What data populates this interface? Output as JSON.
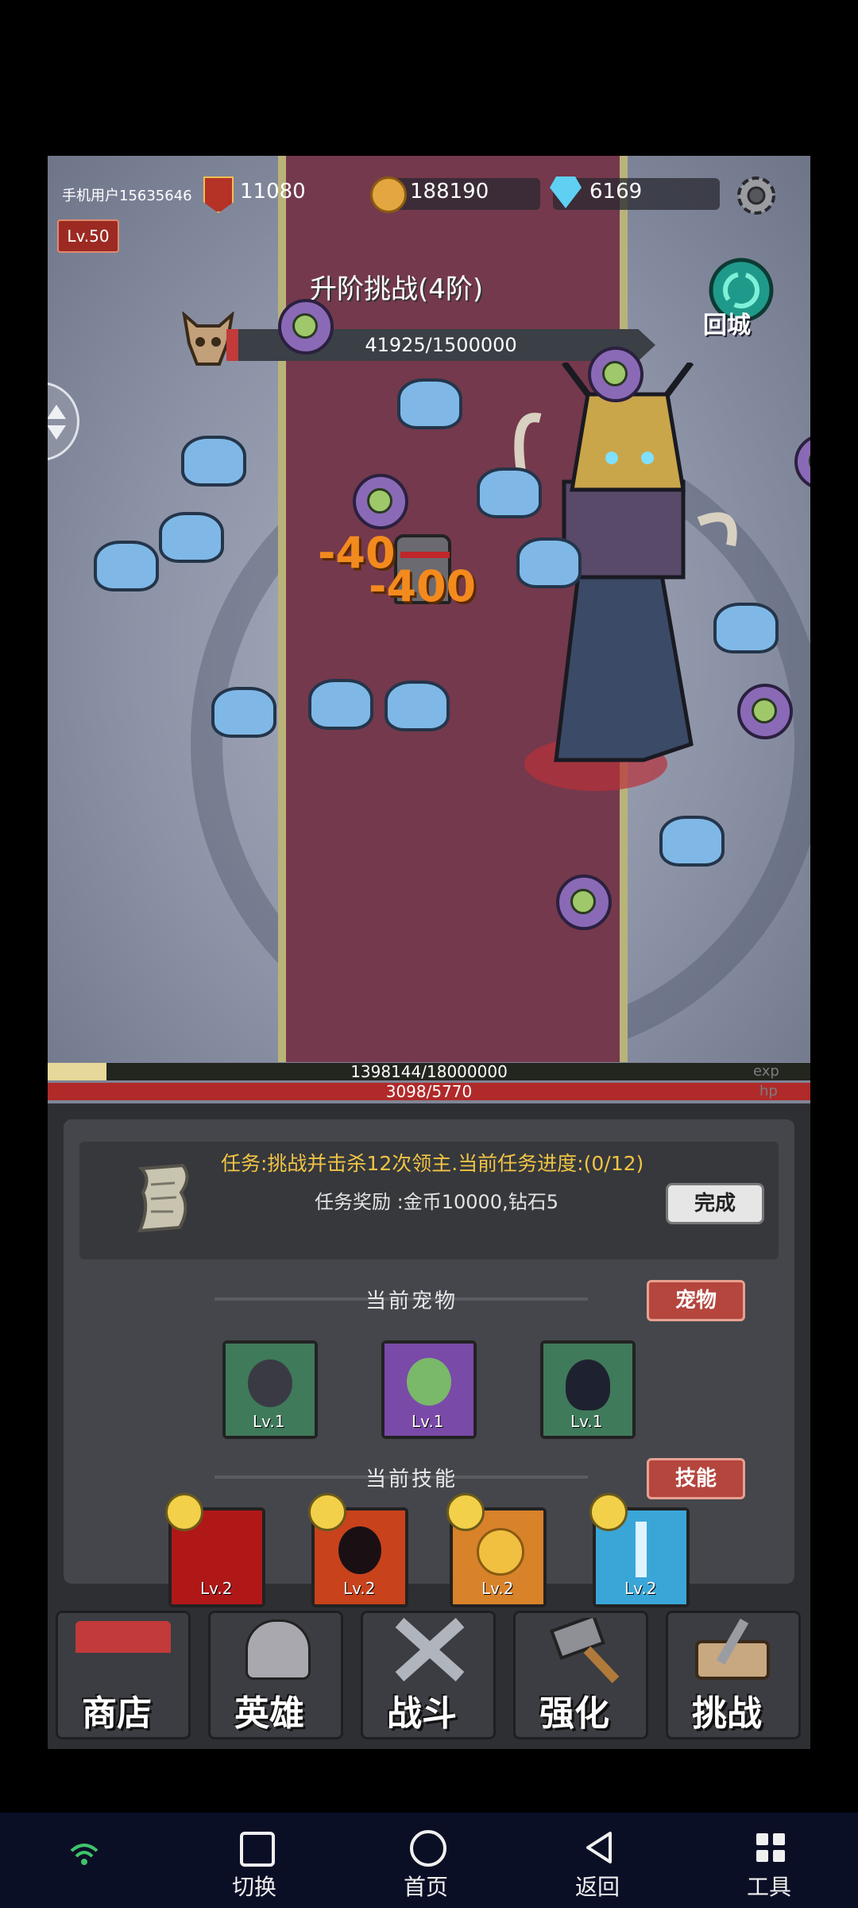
{
  "hud": {
    "username": "手机用户15635646",
    "power": "11080",
    "gold": "188190",
    "diamonds": "6169",
    "level": "Lv.50"
  },
  "boss": {
    "title": "升阶挑战(4阶)",
    "hp": "41925/1500000",
    "hp_fraction": 0.028
  },
  "town_button": "回城",
  "damage_numbers": [
    "-40",
    "-400"
  ],
  "player_bars": {
    "exp": "1398144/18000000",
    "exp_label": "exp",
    "hp": "3098/5770",
    "hp_label": "hp"
  },
  "mission": {
    "title": "任务:挑战并击杀12次领主.当前任务进度:(0/12)",
    "reward": "任务奖励 :金币10000,钻石5",
    "complete_button": "完成"
  },
  "pets": {
    "section_label": "当前宠物",
    "button": "宠物",
    "items": [
      {
        "name": "rat",
        "level": "Lv.1",
        "bg": "#3f7a5a"
      },
      {
        "name": "turtle",
        "level": "Lv.1",
        "bg": "#7a4aa8"
      },
      {
        "name": "penguin",
        "level": "Lv.1",
        "bg": "#3f7a5a"
      }
    ]
  },
  "skills": {
    "section_label": "当前技能",
    "button": "技能",
    "items": [
      {
        "name": "blade",
        "level": "Lv.2",
        "bg": "#b01818"
      },
      {
        "name": "shadow",
        "level": "Lv.2",
        "bg": "#c8421c"
      },
      {
        "name": "coin",
        "level": "Lv.2",
        "bg": "#d8822a"
      },
      {
        "name": "ice-sword",
        "level": "Lv.2",
        "bg": "#3aa6d8"
      }
    ]
  },
  "menu": [
    "商店",
    "英雄",
    "战斗",
    "强化",
    "挑战"
  ],
  "navbar": {
    "switch": "切换",
    "home": "首页",
    "back": "返回",
    "tools": "工具"
  },
  "colors": {
    "gold_text": "#f0c444",
    "damage": "#f38a1e",
    "hp_red": "#b02a2a",
    "exp_fill": "#e6d89a"
  }
}
